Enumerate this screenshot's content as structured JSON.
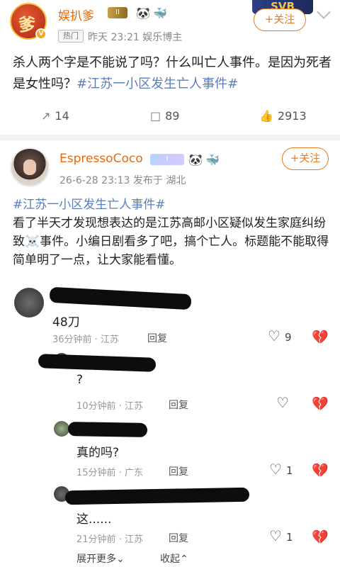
{
  "post1": {
    "avatar_char": "爹",
    "verified_mark": "V",
    "username": "娱扒爹",
    "level": "II",
    "banner_text": "SVB",
    "follow_label": "+关注",
    "tag_label": "热门",
    "meta": "昨天 23:21  娱乐博主",
    "text_main": "杀人两个字是不能说了吗？什么叫亡人事件。是因为死者是女性吗？",
    "hashtag": "#江苏一小区发生亡人事件#",
    "reposts": "14",
    "comments": "89",
    "likes": "2913"
  },
  "post2": {
    "username": "EspressoCoco",
    "level": "I",
    "follow_label": "+关注",
    "meta": "26-6-28 23:13  发布于 湖北",
    "hashtag": "#江苏一小区发生亡人事件#",
    "text_main": "看了半天才发现想表达的是江苏高邮小区疑似发生家庭纠纷致☠️事件。小编日剧看多了吧，搞个亡人。标题能不能取得简单明了一点，让大家能看懂。"
  },
  "comments": [
    {
      "text": "48刀",
      "time": "36分钟前 · 江苏",
      "reply": "回复",
      "likes": "9"
    },
    {
      "text": "?",
      "time": "10分钟前 · 江苏",
      "reply": "回复",
      "likes": ""
    },
    {
      "text": "真的吗?",
      "time": "15分钟前 · 广东",
      "reply": "回复",
      "likes": "1"
    },
    {
      "text": "这......",
      "time": "21分钟前 · 江苏",
      "reply": "回复",
      "likes": "1"
    }
  ],
  "footer": {
    "expand": "展开更多⌄",
    "collapse": "收起⌃"
  },
  "icons": {
    "repost": "↗",
    "comment": "□",
    "like": "👍",
    "heart": "♡",
    "broken_heart": "💔"
  },
  "colors": {
    "username": "#e8680c",
    "hashtag": "#5a7dbd",
    "follow": "#e47d20"
  }
}
